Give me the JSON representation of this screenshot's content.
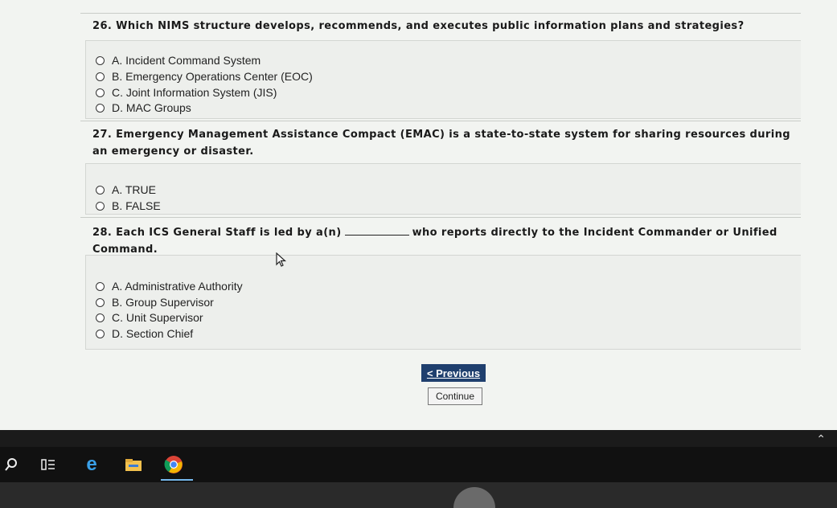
{
  "questions": [
    {
      "title": "26. Which NIMS structure develops, recommends, and executes public information plans and strategies?",
      "options": [
        "A. Incident Command System",
        "B. Emergency Operations Center (EOC)",
        "C. Joint Information System (JIS)",
        "D. MAC Groups"
      ]
    },
    {
      "title": "27. Emergency Management Assistance Compact (EMAC) is a state-to-state system for sharing resources during an emergency or disaster.",
      "options": [
        "A. TRUE",
        "B. FALSE"
      ]
    },
    {
      "title_part1": "28. Each ICS General Staff is led by a(n)",
      "title_part2": "who reports directly to the Incident Commander or Unified Command.",
      "options": [
        "A. Administrative Authority",
        "B. Group Supervisor",
        "C. Unit Supervisor",
        "D. Section Chief"
      ]
    }
  ],
  "nav": {
    "previous_label": "< Previous",
    "continue_label": "Continue"
  }
}
